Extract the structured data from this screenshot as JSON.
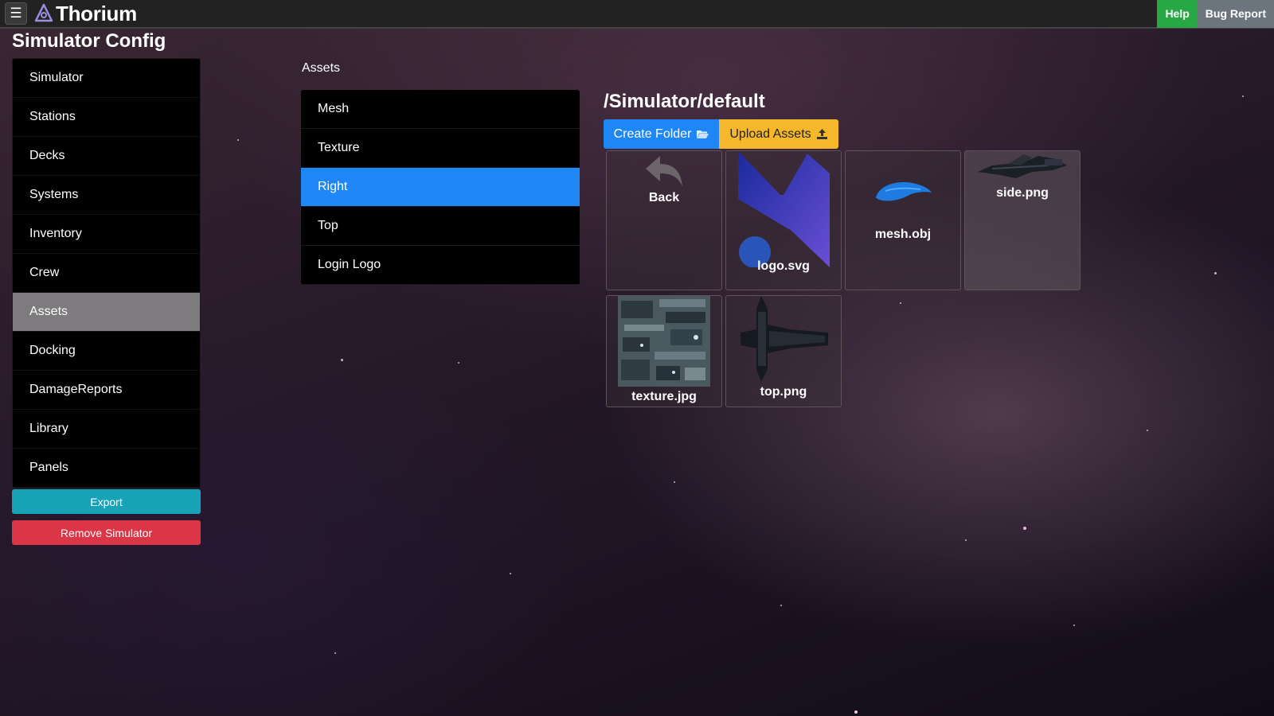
{
  "navbar": {
    "brand": "Thorium",
    "help_label": "Help",
    "bug_report_label": "Bug Report"
  },
  "page_title": "Simulator Config",
  "sidebar": {
    "items": [
      {
        "label": "Simulator"
      },
      {
        "label": "Stations"
      },
      {
        "label": "Decks"
      },
      {
        "label": "Systems"
      },
      {
        "label": "Inventory"
      },
      {
        "label": "Crew"
      },
      {
        "label": "Assets",
        "active": true
      },
      {
        "label": "Docking"
      },
      {
        "label": "DamageReports"
      },
      {
        "label": "Library"
      },
      {
        "label": "Panels"
      }
    ],
    "export_label": "Export",
    "remove_label": "Remove Simulator"
  },
  "assets": {
    "heading": "Assets",
    "items": [
      {
        "label": "Mesh"
      },
      {
        "label": "Texture"
      },
      {
        "label": "Right",
        "active": true
      },
      {
        "label": "Top"
      },
      {
        "label": "Login Logo"
      }
    ]
  },
  "browser": {
    "path": "/Simulator/default",
    "create_folder_label": "Create Folder",
    "upload_assets_label": "Upload Assets",
    "tiles": [
      {
        "label": "Back",
        "icon": "back-arrow-icon"
      },
      {
        "label": "logo.svg"
      },
      {
        "label": "mesh.obj"
      },
      {
        "label": "side.png"
      },
      {
        "label": "texture.jpg"
      },
      {
        "label": "top.png"
      }
    ]
  },
  "colors": {
    "primary": "#1e86f5",
    "warning": "#f5b82b",
    "success": "#28a745",
    "info": "#17a2b8",
    "danger": "#dc3545",
    "secondary": "#6c757d"
  }
}
